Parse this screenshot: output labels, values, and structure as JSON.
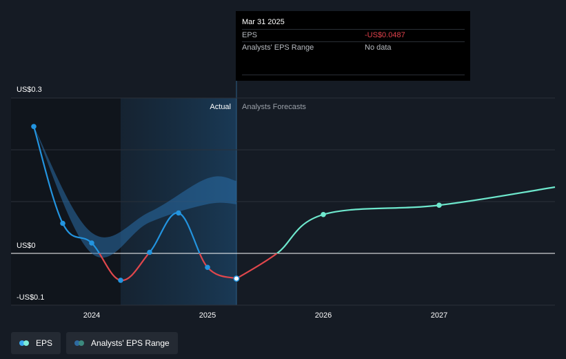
{
  "tooltip": {
    "date": "Mar 31 2025",
    "eps_label": "EPS",
    "eps_value": "-US$0.0487",
    "range_label": "Analysts' EPS Range",
    "range_value": "No data"
  },
  "legend": {
    "eps_label": "EPS",
    "range_label": "Analysts' EPS Range",
    "eps_colors": [
      "#38a8f0",
      "#7cecda"
    ],
    "range_colors": [
      "#2e6aa0",
      "#3c8a7e"
    ]
  },
  "colors": {
    "actual": "#2394df",
    "negative": "#e0474c",
    "forecast": "#6ee8cd",
    "range_band": "#2a6da8"
  },
  "chart_data": {
    "type": "line",
    "x_axis": {
      "ticks": [
        "2024",
        "2025",
        "2026",
        "2027"
      ],
      "range": [
        2023.4,
        2028.0
      ]
    },
    "y_axis": {
      "ticks": [
        "US$0.3",
        "US$0",
        "-US$0.1"
      ],
      "range": [
        -0.1,
        0.3
      ]
    },
    "gridlines": true,
    "region_labels": {
      "actual": "Actual",
      "forecast": "Analysts Forecasts"
    },
    "divider_x": 2025.25,
    "eps_actual": {
      "name": "EPS",
      "x": [
        2023.5,
        2023.75,
        2024.0,
        2024.25,
        2024.5,
        2024.75,
        2025.0,
        2025.25
      ],
      "y": [
        0.245,
        0.058,
        0.02,
        -0.052,
        0.002,
        0.078,
        -0.027,
        -0.0487
      ]
    },
    "eps_forecast": {
      "name": "EPS",
      "x": [
        2025.25,
        2025.6,
        2026.0,
        2027.0,
        2028.0
      ],
      "y": [
        -0.0487,
        0.0,
        0.075,
        0.093,
        0.128
      ]
    },
    "analysts_eps_range": {
      "name": "Analysts' EPS Range",
      "x": [
        2023.5,
        2024.0,
        2024.5,
        2025.0,
        2025.25
      ],
      "low": [
        0.245,
        0.0,
        0.06,
        0.095,
        0.095
      ],
      "high": [
        0.245,
        0.04,
        0.08,
        0.145,
        0.14
      ]
    }
  }
}
